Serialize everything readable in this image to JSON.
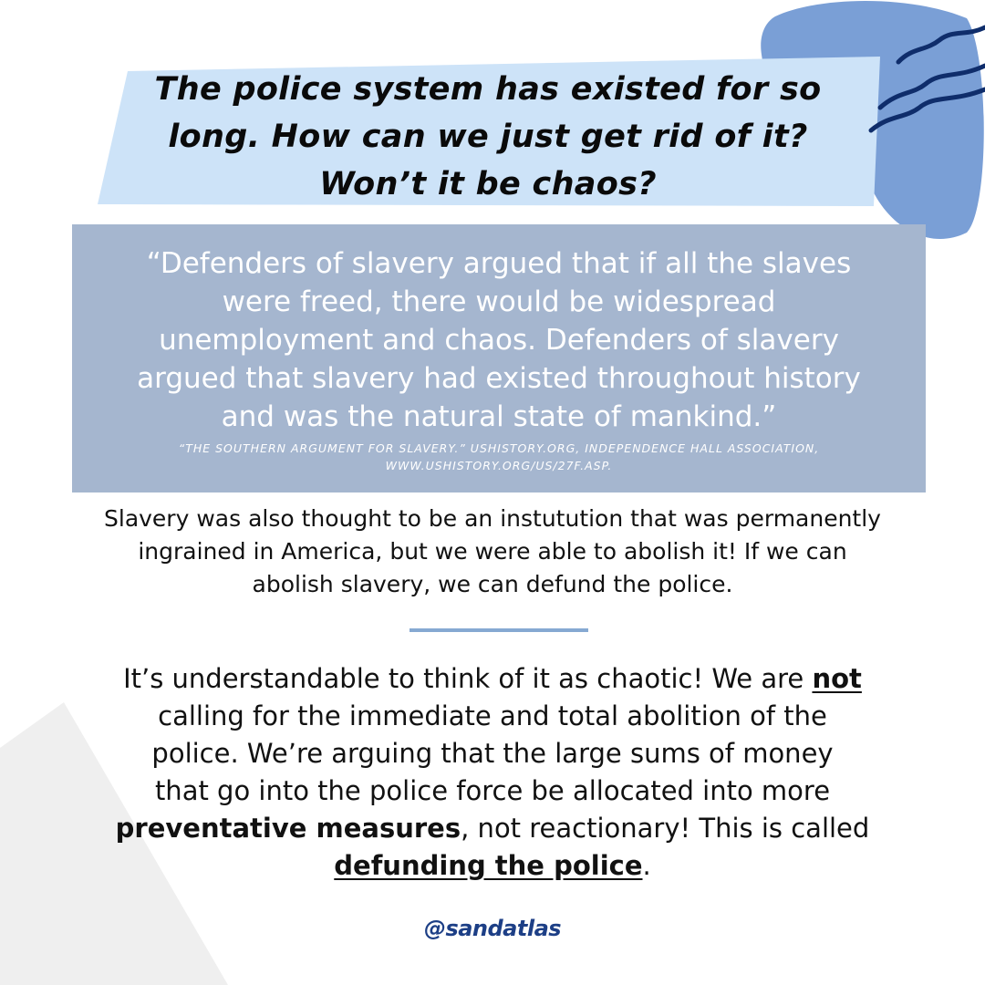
{
  "colors": {
    "title_bg": "#cde3f8",
    "blob": "#7a9fd6",
    "squiggle": "#0f2d6b",
    "quote_box": "#a5b6cf",
    "divider": "#86a9d2",
    "triangle": "#efefef",
    "handle": "#1d3f86"
  },
  "title": {
    "line1": "The police system has existed for so",
    "line2": "long. How can we just get rid of it?",
    "line3": "Won’t it be chaos?"
  },
  "quote": {
    "line1": "“Defenders of slavery argued that if all the slaves",
    "line2": "were freed, there would be widespread",
    "line3": "unemployment and chaos. Defenders of slavery",
    "line4": "argued that slavery had existed throughout history",
    "line5": "and was the natural state of mankind.”",
    "source_line1": "“The Southern Argument for Slavery.” Ushistory.org, Independence Hall Association,",
    "source_line2": "www.ushistory.org/us/27f.asp."
  },
  "para1": {
    "line1": "Slavery was also thought to be an instutution that was permanently",
    "line2": "ingrained in America, but we were able to abolish it! If we can",
    "line3": "abolish slavery, we can defund the police."
  },
  "para2": {
    "l1a": "It’s understandable to think of it as chaotic! We are ",
    "l1b": "not",
    "l2": "calling for the immediate and total abolition of the",
    "l3": "police. We’re arguing that the large sums of money",
    "l4": "that go into the police force be allocated into more",
    "l5a": "preventative measures",
    "l5b": ", not reactionary! This is called",
    "l6a": "defunding the police",
    "l6b": "."
  },
  "handle": "@sandatlas"
}
